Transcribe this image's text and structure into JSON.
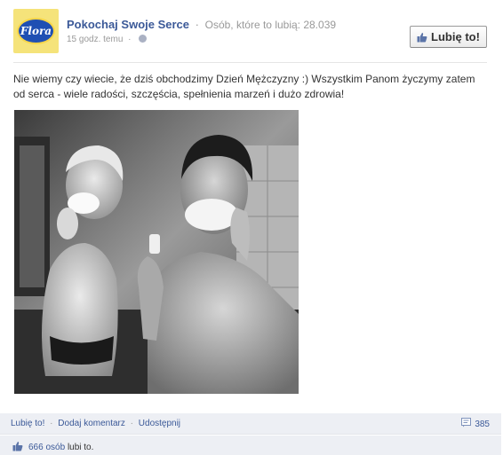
{
  "page": {
    "logo_text": "Flora",
    "name": "Pokochaj Swoje Serce",
    "likes_text": "Osób, które to lubią: 28.039",
    "timestamp": "15 godz. temu"
  },
  "like_button": {
    "label": "Lubię to!"
  },
  "post": {
    "text": "Nie wiemy czy wiecie, że dziś obchodzimy Dzień Mężczyzny :) Wszystkim Panom życzymy zatem od serca - wiele radości, szczęścia, spełnienia marzeń i dużo zdrowia!",
    "photo_alt": "Ojciec i syn golący się przed lustrem"
  },
  "actions": {
    "like": "Lubię to!",
    "comment": "Dodaj komentarz",
    "share": "Udostępnij",
    "comment_count": "385"
  },
  "likes": {
    "count": "666 osób",
    "suffix": "lubi to."
  },
  "colors": {
    "link": "#3b5998",
    "muted": "#999999",
    "action_bar_bg": "#edeff4"
  }
}
